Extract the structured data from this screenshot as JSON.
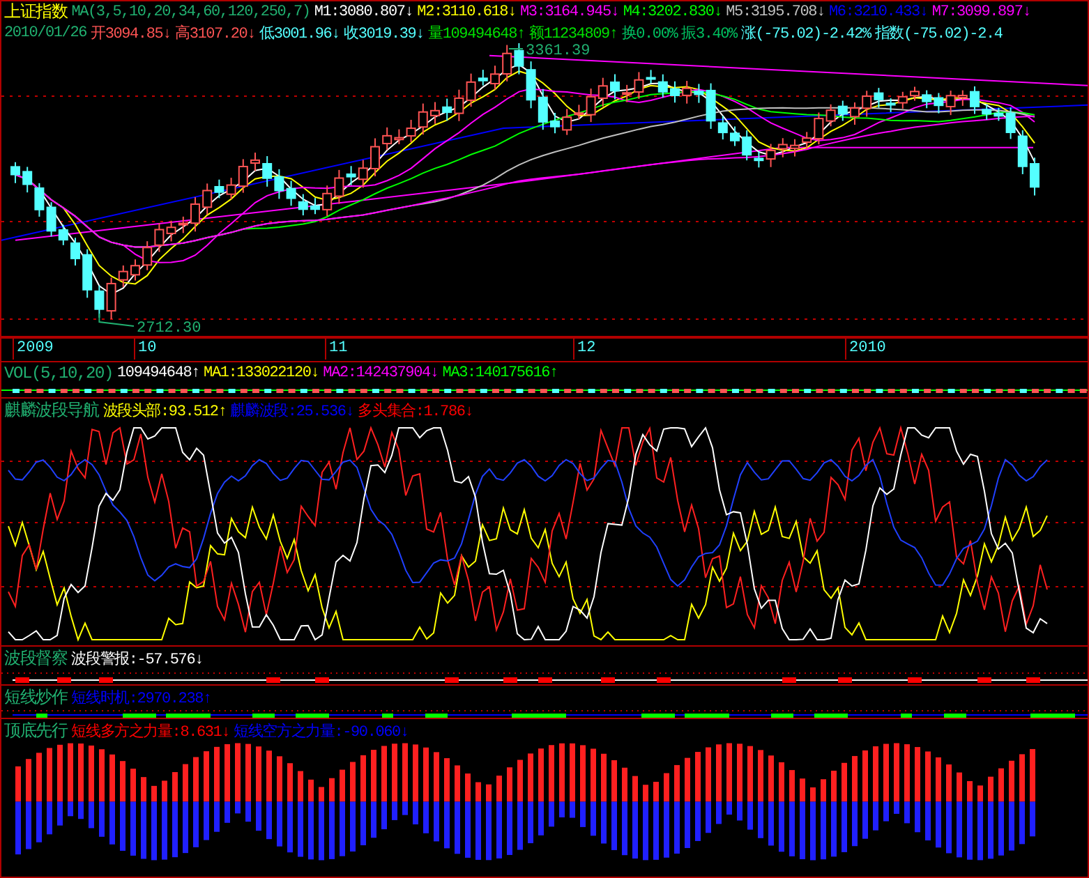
{
  "main": {
    "title": "上证指数",
    "ma_label": "MA(3,5,10,20,34,60,120,250,7)",
    "indicators": [
      {
        "label": "M1:3080.807",
        "arrow": "↓",
        "color": "#ffffff"
      },
      {
        "label": "M2:3110.618",
        "arrow": "↓",
        "color": "#ffff00"
      },
      {
        "label": "M3:3164.945",
        "arrow": "↓",
        "color": "#ff00ff"
      },
      {
        "label": "M4:3202.830",
        "arrow": "↓",
        "color": "#00ff00"
      },
      {
        "label": "M5:3195.708",
        "arrow": "↓",
        "color": "#c0c0c0"
      },
      {
        "label": "M6:3210.433",
        "arrow": "↓",
        "color": "#0000ff"
      },
      {
        "label": "M7:3099.897",
        "arrow": "↓",
        "color": "#ff00ff"
      }
    ],
    "date": "2010/01/26",
    "quotes": [
      {
        "label": "开3094.85",
        "arrow": "↓",
        "color": "#ff5454"
      },
      {
        "label": "高3107.20",
        "arrow": "↓",
        "color": "#ff5454"
      },
      {
        "label": "低3001.96",
        "arrow": "↓",
        "color": "#54ffff"
      },
      {
        "label": "收3019.39",
        "arrow": "↓",
        "color": "#54ffff"
      },
      {
        "label": "量109494648",
        "arrow": "↑",
        "color": "#00e000"
      },
      {
        "label": "额11234809",
        "arrow": "↑",
        "color": "#00e000"
      },
      {
        "label": "换0.00%",
        "color": "#00c060"
      },
      {
        "label": "振3.40%",
        "color": "#00c060"
      },
      {
        "label": "涨(-75.02)-2.42%",
        "color": "#54ffff"
      },
      {
        "label": "指数(-75.02)-2.4",
        "color": "#54ffff"
      }
    ],
    "high_label": "3361.39",
    "low_label": "2712.30"
  },
  "time_axis": [
    "2009",
    "10",
    "11",
    "12",
    "2010"
  ],
  "volume": {
    "title": "VOL(5,10,20)",
    "indicators": [
      {
        "label": "109494648",
        "arrow": "↑",
        "color": "#ffffff"
      },
      {
        "label": "MA1:133022120",
        "arrow": "↓",
        "color": "#ffff00"
      },
      {
        "label": "MA2:142437904",
        "arrow": "↓",
        "color": "#ff00ff"
      },
      {
        "label": "MA3:140175616",
        "arrow": "↑",
        "color": "#00ff00"
      }
    ]
  },
  "panels": [
    {
      "kind": "wave",
      "title": "麒麟波段导航",
      "indicators": [
        {
          "label": "波段头部:93.512",
          "arrow": "↑",
          "color": "#ffff00"
        },
        {
          "label": "麒麟波段:25.536",
          "arrow": "↓",
          "color": "#0000ff"
        },
        {
          "label": "多头集合:1.786",
          "arrow": "↓",
          "color": "#ff0000"
        }
      ]
    },
    {
      "kind": "alert",
      "title": "波段督察",
      "indicators": [
        {
          "label": "波段警报:-57.576",
          "arrow": "↓",
          "color": "#ffffff"
        }
      ]
    },
    {
      "kind": "timing",
      "title": "短线炒作",
      "indicators": [
        {
          "label": "短线时机:2970.238",
          "arrow": "↑",
          "color": "#0000ff"
        }
      ]
    },
    {
      "kind": "bars",
      "title": "顶底先行",
      "indicators": [
        {
          "label": "短线多方之力量:8.631",
          "arrow": "↓",
          "color": "#ff0000"
        },
        {
          "label": "短线空方之力量:-90.060",
          "arrow": "↓",
          "color": "#0000ff"
        }
      ]
    }
  ]
}
